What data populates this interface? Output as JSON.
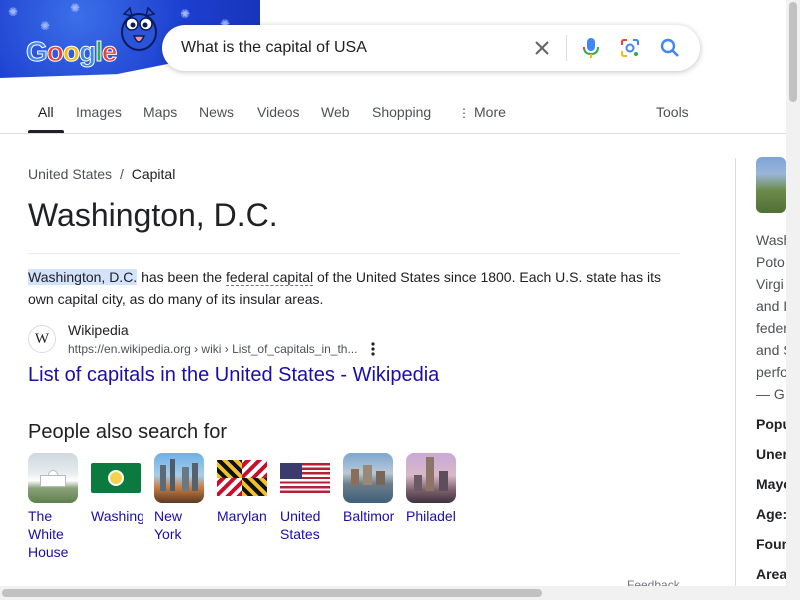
{
  "search": {
    "query": "What is the capital of USA"
  },
  "logo": {
    "text": "Google"
  },
  "tabs": [
    {
      "label": "All",
      "active": true
    },
    {
      "label": "Images"
    },
    {
      "label": "Maps"
    },
    {
      "label": "News"
    },
    {
      "label": "Videos"
    },
    {
      "label": "Web"
    },
    {
      "label": "Shopping"
    },
    {
      "label": "More"
    }
  ],
  "tools_label": "Tools",
  "answer": {
    "breadcrumb": {
      "parent": "United States",
      "separator": "/",
      "current": "Capital"
    },
    "title": "Washington, D.C.",
    "snippet": {
      "highlight": "Washington, D.C.",
      "part1": " has been the ",
      "link": "federal capital",
      "part2": " of the United States since 1800. Each U.S. state has its own capital city, as do many of its insular areas."
    },
    "source": {
      "favicon": "W",
      "name": "Wikipedia",
      "url": "https://en.wikipedia.org › wiki › List_of_capitals_in_th...",
      "link_title": "List of capitals in the United States - Wikipedia"
    }
  },
  "people_also_search": {
    "heading": "People also search for",
    "items": [
      {
        "label": "The White House"
      },
      {
        "label": "Washing"
      },
      {
        "label": "New York"
      },
      {
        "label": "Marylan"
      },
      {
        "label": "United States"
      },
      {
        "label": "Baltimor"
      },
      {
        "label": "Philadel"
      }
    ]
  },
  "feedback": "Feedback",
  "knowledge_panel": {
    "text_lines": [
      "Wash",
      "Poto",
      "Virgi",
      "and I",
      "feder",
      "and S",
      "perfo",
      "— G"
    ],
    "facts": [
      "Popu",
      "Uner",
      "Mayo",
      "Age:",
      "Foun",
      "Area"
    ]
  },
  "colors": {
    "link": "#1a0dab",
    "highlight": "#d3e3fd",
    "doodle_blue": "#1d3fd0"
  }
}
